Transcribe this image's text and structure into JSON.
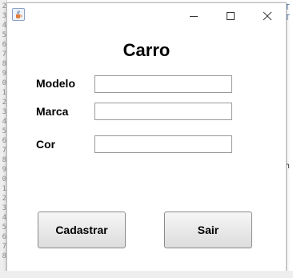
{
  "background": {
    "line_numbers": [
      "2",
      "3",
      "4",
      "5",
      "6",
      "7",
      "8",
      "9",
      "0",
      "1",
      "2",
      "3",
      "4",
      "5",
      "6",
      "7",
      "8",
      "9",
      "0",
      "1",
      "2",
      "3",
      "4",
      "5",
      "6",
      "7",
      "8"
    ],
    "right_code_snippets": [
      "T",
      "T",
      "n"
    ]
  },
  "window": {
    "icon": "java-cup-icon",
    "controls": {
      "minimize": "minimize-icon",
      "maximize": "maximize-icon",
      "close": "close-icon"
    }
  },
  "form": {
    "title": "Carro",
    "fields": [
      {
        "label": "Modelo",
        "value": ""
      },
      {
        "label": "Marca",
        "value": ""
      },
      {
        "label": "Cor",
        "value": ""
      }
    ],
    "buttons": {
      "submit": "Cadastrar",
      "exit": "Sair"
    }
  }
}
